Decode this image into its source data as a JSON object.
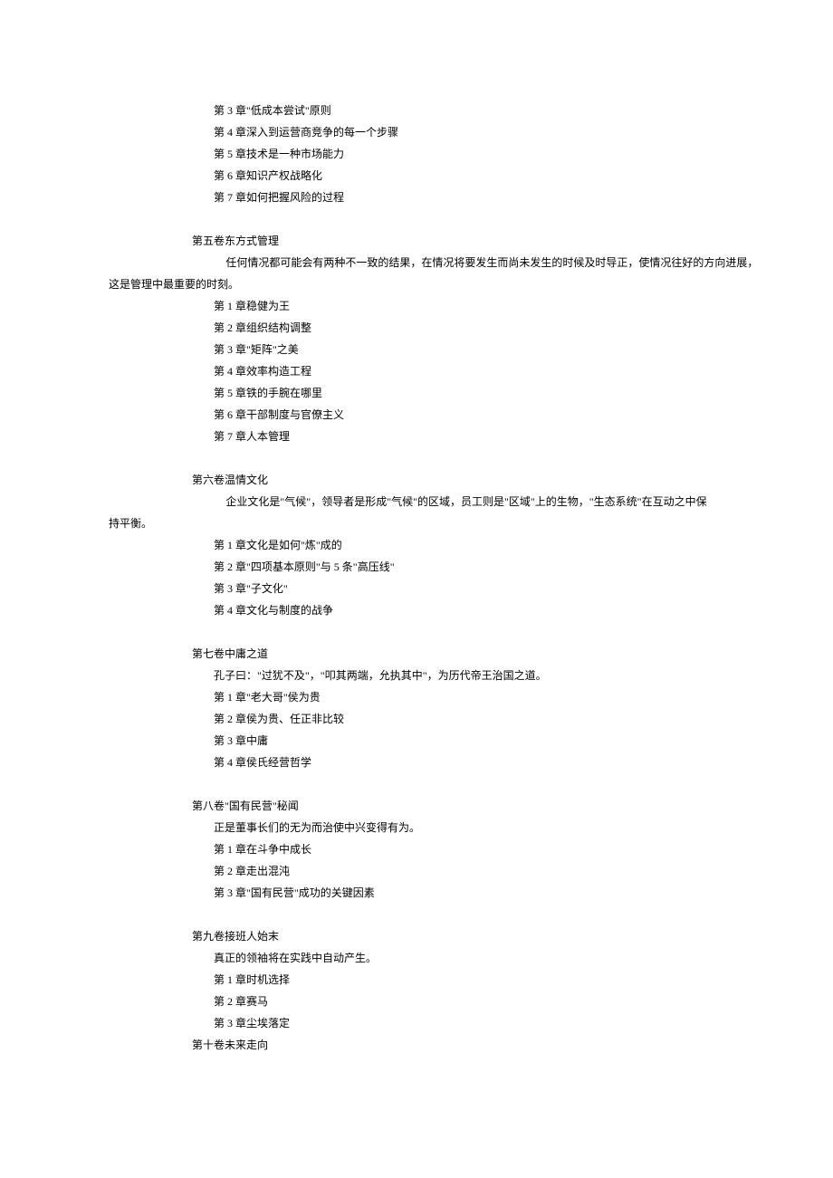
{
  "sections": [
    {
      "chapters": [
        "第 3 章\"低成本尝试\"原则",
        "第 4 章深入到运营商竞争的每一个步骤",
        "第 5 章技术是一种市场能力",
        "第 6 章知识产权战略化",
        "第 7 章如何把握风险的过程"
      ]
    },
    {
      "title": "第五卷东方式管理",
      "desc": "任何情况都可能会有两种不一致的结果，在情况将要发生而尚未发生的时候及时导正，使情况往好的方向进展，",
      "desc_cont": "这是管理中最重要的时刻。",
      "chapters": [
        "第 1 章稳健为王",
        "第 2 章组织结构调整",
        "第 3 章\"矩阵\"之美",
        "第 4 章效率构造工程",
        "第 5 章铁的手腕在哪里",
        "第 6 章干部制度与官僚主义",
        "第 7 章人本管理"
      ]
    },
    {
      "title": "第六卷温情文化",
      "desc": "企业文化是\"气候\"，领导者是形成\"气候\"的区域，员工则是\"区域\"上的生物，\"生态系统\"在互动之中保",
      "desc_cont": "持平衡。",
      "chapters": [
        "第 1 章文化是如何\"炼\"成的",
        "第 2 章\"四项基本原则\"与 5 条\"高压线\"",
        "第 3 章\"子文化\"",
        "第 4 章文化与制度的战争"
      ]
    },
    {
      "title": "第七卷中庸之道",
      "desc_inline": "孔子曰：\"过犹不及\"，\"叩其两端，允执其中\"，为历代帝王治国之道。",
      "chapters": [
        "第 1 章\"老大哥\"侯为贵",
        "第 2 章侯为贵、任正非比较",
        "第 3 章中庸",
        "第 4 章侯氏经营哲学"
      ]
    },
    {
      "title": "第八卷\"国有民营\"秘闻",
      "desc_inline": "正是董事长们的无为而治使中兴变得有为。",
      "chapters": [
        "第 1 章在斗争中成长",
        "第 2 章走出混沌",
        "第 3 章\"国有民营\"成功的关键因素"
      ]
    },
    {
      "title": "第九卷接班人始末",
      "desc_inline": "真正的领袖将在实践中自动产生。",
      "chapters": [
        "第 1 章时机选择",
        "第 2 章赛马",
        "第 3 章尘埃落定"
      ]
    },
    {
      "title": "第十卷未来走向"
    }
  ]
}
